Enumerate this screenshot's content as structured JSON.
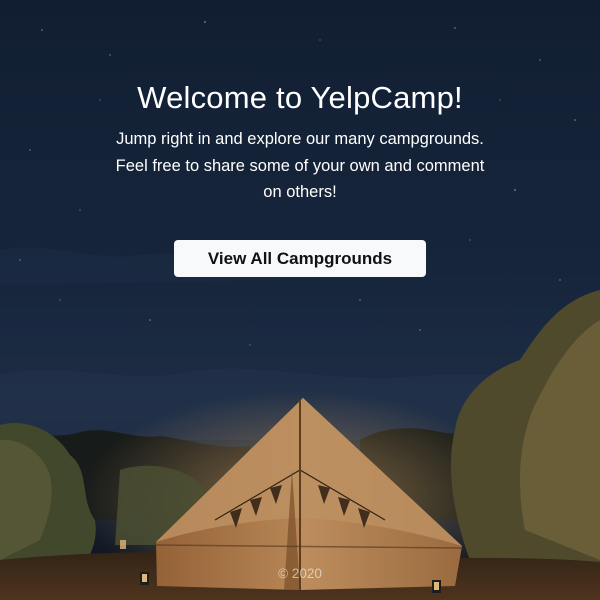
{
  "hero": {
    "title": "Welcome to YelpCamp!",
    "lead": "Jump right in and explore our many campgrounds. Feel free to share some of your own and comment on others!",
    "cta_label": "View All Campgrounds"
  },
  "footer": {
    "copyright": "© 2020"
  },
  "colors": {
    "sky_top": "#14233a",
    "tent": "#c8905a",
    "button_bg": "#f8f9fa"
  }
}
